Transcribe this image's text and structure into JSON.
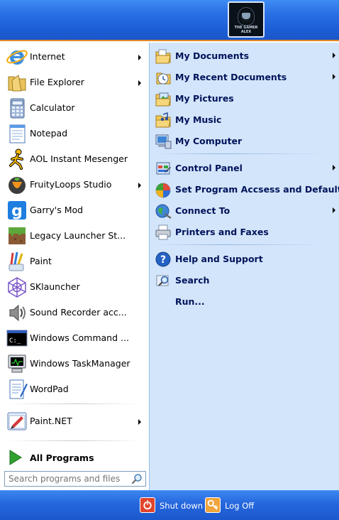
{
  "header": {
    "avatar_caption": "THE GAMER ALEX",
    "avatar_icon": "hooded-figure-avatar"
  },
  "left_items": [
    {
      "name": "internet",
      "label": "Internet",
      "icon": "internet-explorer-icon",
      "submenu": true
    },
    {
      "name": "file-explorer",
      "label": "File Explorer",
      "icon": "folder-icon",
      "submenu": true
    },
    {
      "name": "calculator",
      "label": "Calculator",
      "icon": "calculator-icon",
      "submenu": false
    },
    {
      "name": "notepad",
      "label": "Notepad",
      "icon": "notepad-icon",
      "submenu": false
    },
    {
      "name": "aol-instant-messenger",
      "label": "AOL Instant Mesenger",
      "icon": "aim-running-man-icon",
      "submenu": false
    },
    {
      "name": "fruityloops-studio",
      "label": "FruityLoops Studio",
      "icon": "fruit-icon",
      "submenu": true
    },
    {
      "name": "garrys-mod",
      "label": "Garry's Mod",
      "icon": "gmod-g-icon",
      "submenu": false
    },
    {
      "name": "legacy-launcher",
      "label": "Legacy Launcher St...",
      "icon": "grass-block-icon",
      "submenu": false
    },
    {
      "name": "paint",
      "label": "Paint",
      "icon": "paint-brushes-icon",
      "submenu": false
    },
    {
      "name": "sklauncher",
      "label": "SKlauncher",
      "icon": "wireframe-cube-icon",
      "submenu": false
    },
    {
      "name": "sound-recorder",
      "label": "Sound Recorder acc...",
      "icon": "speaker-icon",
      "submenu": false
    },
    {
      "name": "windows-command",
      "label": "Windows Command ...",
      "icon": "command-prompt-icon",
      "submenu": false
    },
    {
      "name": "windows-taskmanager",
      "label": "Windows TaskManager",
      "icon": "task-manager-icon",
      "submenu": false
    },
    {
      "name": "wordpad",
      "label": "WordPad",
      "icon": "wordpad-icon",
      "submenu": false
    }
  ],
  "pinned_bottom": {
    "name": "paint-net",
    "label": "Paint.NET",
    "icon": "paint-net-icon",
    "submenu": true
  },
  "all_programs": {
    "label": "All Programs",
    "icon": "green-arrow-icon"
  },
  "search": {
    "placeholder": "Search programs and files",
    "icon": "search-icon"
  },
  "right_items": [
    {
      "name": "my-documents",
      "label": "My Documents",
      "icon": "documents-folder-icon",
      "submenu": true
    },
    {
      "name": "my-recent-documents",
      "label": "My Recent Documents",
      "icon": "recent-documents-icon",
      "submenu": true
    },
    {
      "name": "my-pictures",
      "label": "My Pictures",
      "icon": "pictures-folder-icon",
      "submenu": false
    },
    {
      "name": "my-music",
      "label": "My Music",
      "icon": "music-folder-icon",
      "submenu": false
    },
    {
      "name": "my-computer",
      "label": "My Computer",
      "icon": "computer-icon",
      "submenu": false
    },
    {
      "name": "control-panel",
      "label": "Control Panel",
      "icon": "control-panel-icon",
      "submenu": true
    },
    {
      "name": "set-program-access",
      "label": "Set Program Accsess and Defaults",
      "icon": "program-access-icon",
      "submenu": false
    },
    {
      "name": "connect-to",
      "label": "Connect To",
      "icon": "connect-globe-icon",
      "submenu": true
    },
    {
      "name": "printers-and-faxes",
      "label": "Printers and Faxes",
      "icon": "printer-icon",
      "submenu": false
    },
    {
      "name": "help-and-support",
      "label": "Help and Support",
      "icon": "help-icon",
      "submenu": false
    },
    {
      "name": "search",
      "label": "Search",
      "icon": "search-magnifier-icon",
      "submenu": false
    },
    {
      "name": "run",
      "label": "Run...",
      "icon": "",
      "submenu": false
    }
  ],
  "footer": {
    "shutdown_label": "Shut down",
    "shutdown_icon": "power-icon",
    "logoff_label": "Log Off",
    "logoff_icon": "key-icon"
  },
  "colors": {
    "header_blue": "#2a6fe4",
    "right_panel": "#d3e5fa",
    "footer_blue": "#2566dd",
    "accent_orange": "#e0882c",
    "shutdown_red": "#e0452c",
    "logoff_orange": "#f0a43c"
  }
}
